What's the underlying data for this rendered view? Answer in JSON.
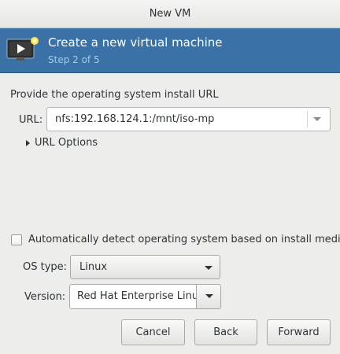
{
  "window": {
    "title": "New VM"
  },
  "banner": {
    "title": "Create a new virtual machine",
    "step": "Step 2 of 5",
    "icon": "virtual-machine-icon",
    "color": "#3a72a8"
  },
  "install": {
    "prompt": "Provide the operating system install URL",
    "url_label": "URL:",
    "url_value": "nfs:192.168.124.1:/mnt/iso-mp",
    "url_options_label": "URL Options"
  },
  "os": {
    "auto_detect_label": "Automatically detect operating system based on install media",
    "auto_detect_checked": false,
    "os_type_label": "OS type:",
    "os_type_value": "Linux",
    "version_label": "Version:",
    "version_value": "Red Hat Enterprise Linux"
  },
  "buttons": {
    "cancel": "Cancel",
    "back": "Back",
    "forward": "Forward"
  }
}
